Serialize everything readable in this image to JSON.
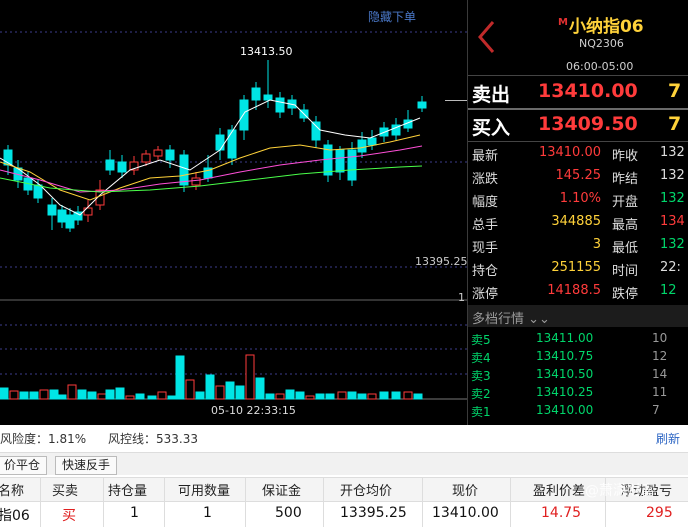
{
  "chart": {
    "hide_orders_link": "隐藏下单",
    "peak_label": "13413.50",
    "price_line_label": "13395.25",
    "volume_axis_label": "1",
    "cursor_time": "05-10 22:33:15"
  },
  "quote": {
    "symbol_badge": "M",
    "name": "小纳指06",
    "code": "NQ2306",
    "hours": "06:00-05:00",
    "sell_label": "卖出",
    "sell_price": "13410.00",
    "sell_qty": "7",
    "buy_label": "买入",
    "buy_price": "13409.50",
    "buy_qty": "7",
    "rows": [
      {
        "l1": "最新",
        "v1": "13410.00",
        "c1": "#ff3b3b",
        "l2": "昨收",
        "v2": "132",
        "c2": "#dddddd"
      },
      {
        "l1": "涨跌",
        "v1": "145.25",
        "c1": "#ff3b3b",
        "l2": "昨结",
        "v2": "132",
        "c2": "#dddddd"
      },
      {
        "l1": "幅度",
        "v1": "1.10%",
        "c1": "#ff3b3b",
        "l2": "开盘",
        "v2": "132",
        "c2": "#00d66b"
      },
      {
        "l1": "总手",
        "v1": "344885",
        "c1": "#ffd23a",
        "l2": "最高",
        "v2": "134",
        "c2": "#ff3b3b"
      },
      {
        "l1": "现手",
        "v1": "3",
        "c1": "#ffd23a",
        "l2": "最低",
        "v2": "132",
        "c2": "#00d66b"
      },
      {
        "l1": "持仓",
        "v1": "251155",
        "c1": "#ffd23a",
        "l2": "时间",
        "v2": "22:",
        "c2": "#dddddd"
      },
      {
        "l1": "涨停",
        "v1": "14188.5",
        "c1": "#ff3b3b",
        "l2": "跌停",
        "v2": "12",
        "c2": "#00d66b"
      }
    ],
    "depth_title": "多档行情",
    "depth": [
      {
        "label": "卖5",
        "price": "13411.00",
        "qty": "10"
      },
      {
        "label": "卖4",
        "price": "13410.75",
        "qty": "12"
      },
      {
        "label": "卖3",
        "price": "13410.50",
        "qty": "14"
      },
      {
        "label": "卖2",
        "price": "13410.25",
        "qty": "11"
      },
      {
        "label": "卖1",
        "price": "13410.00",
        "qty": "7"
      }
    ]
  },
  "account": {
    "risk_label": "风险度：1.81%",
    "control_label": "风控线：533.33",
    "refresh": "刷新"
  },
  "actions": {
    "close_label": "价平仓",
    "reverse_label": "快速反手"
  },
  "positions": {
    "headers": [
      "名称",
      "买卖",
      "持仓量",
      "可用数量",
      "保证金",
      "开仓均价",
      "现价",
      "盈利价差",
      "浮动盈亏"
    ],
    "row": [
      "指06",
      "买",
      "1",
      "1",
      "500",
      "13395.25",
      "13410.00",
      "14.75",
      "295"
    ]
  },
  "watermark": "@萧潇财富",
  "colors": {
    "up": "#ff3b3b",
    "down": "#00e5e5",
    "accent": "#ffd23a",
    "bid_green": "#00d66b"
  }
}
